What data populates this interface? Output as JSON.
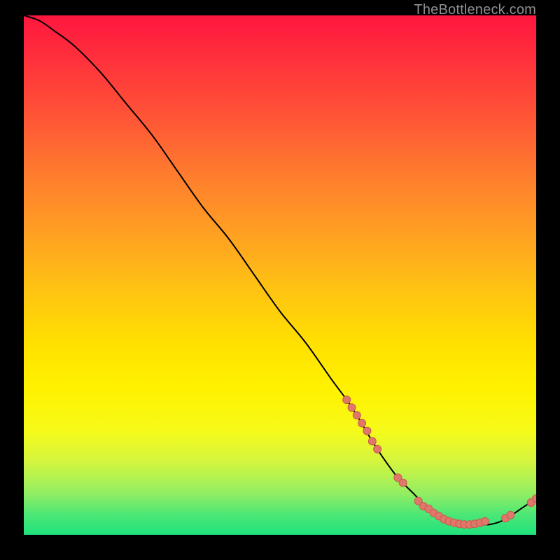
{
  "watermark": "TheBottleneck.com",
  "colors": {
    "background": "#000000",
    "curve_stroke": "#000000",
    "marker_fill": "#e0776b",
    "marker_stroke": "#c95a4e",
    "gradient_top": "#ff163f",
    "gradient_bottom": "#1fe27d"
  },
  "chart_data": {
    "type": "line",
    "title": "",
    "xlabel": "",
    "ylabel": "",
    "xlim": [
      0,
      100
    ],
    "ylim": [
      0,
      100
    ],
    "grid": false,
    "legend": false,
    "series": [
      {
        "name": "bottleneck-curve",
        "x": [
          0,
          3,
          6,
          10,
          15,
          20,
          25,
          30,
          35,
          40,
          45,
          50,
          55,
          60,
          63,
          65,
          68,
          70,
          73,
          76,
          79,
          82,
          85,
          88,
          91,
          94,
          97,
          100
        ],
        "y": [
          100,
          99,
          97,
          94,
          89,
          83,
          77,
          70,
          63,
          57,
          50,
          43,
          37,
          30,
          26,
          23,
          18,
          15,
          11,
          8,
          5,
          3,
          2,
          2,
          2,
          3,
          5,
          7
        ]
      }
    ],
    "markers": [
      {
        "group": "upper-band",
        "points": [
          {
            "x": 63,
            "y": 26
          },
          {
            "x": 64,
            "y": 24.5
          },
          {
            "x": 65,
            "y": 23
          },
          {
            "x": 66,
            "y": 21.5
          },
          {
            "x": 67,
            "y": 20
          },
          {
            "x": 68,
            "y": 18
          },
          {
            "x": 69,
            "y": 16.5
          }
        ]
      },
      {
        "group": "elbow",
        "points": [
          {
            "x": 73,
            "y": 11
          },
          {
            "x": 74,
            "y": 10
          }
        ]
      },
      {
        "group": "valley-long",
        "points": [
          {
            "x": 77,
            "y": 6.5
          },
          {
            "x": 78,
            "y": 5.5
          },
          {
            "x": 79,
            "y": 5
          },
          {
            "x": 80,
            "y": 4.2
          },
          {
            "x": 81,
            "y": 3.6
          },
          {
            "x": 82,
            "y": 3
          },
          {
            "x": 83,
            "y": 2.6
          },
          {
            "x": 84,
            "y": 2.3
          },
          {
            "x": 85,
            "y": 2.1
          },
          {
            "x": 86,
            "y": 2
          },
          {
            "x": 87,
            "y": 2
          },
          {
            "x": 88,
            "y": 2.1
          },
          {
            "x": 89,
            "y": 2.3
          },
          {
            "x": 90,
            "y": 2.6
          }
        ]
      },
      {
        "group": "rise",
        "points": [
          {
            "x": 94,
            "y": 3.2
          },
          {
            "x": 95,
            "y": 3.8
          }
        ]
      },
      {
        "group": "tail",
        "points": [
          {
            "x": 99,
            "y": 6.2
          },
          {
            "x": 100,
            "y": 7
          }
        ]
      }
    ]
  }
}
